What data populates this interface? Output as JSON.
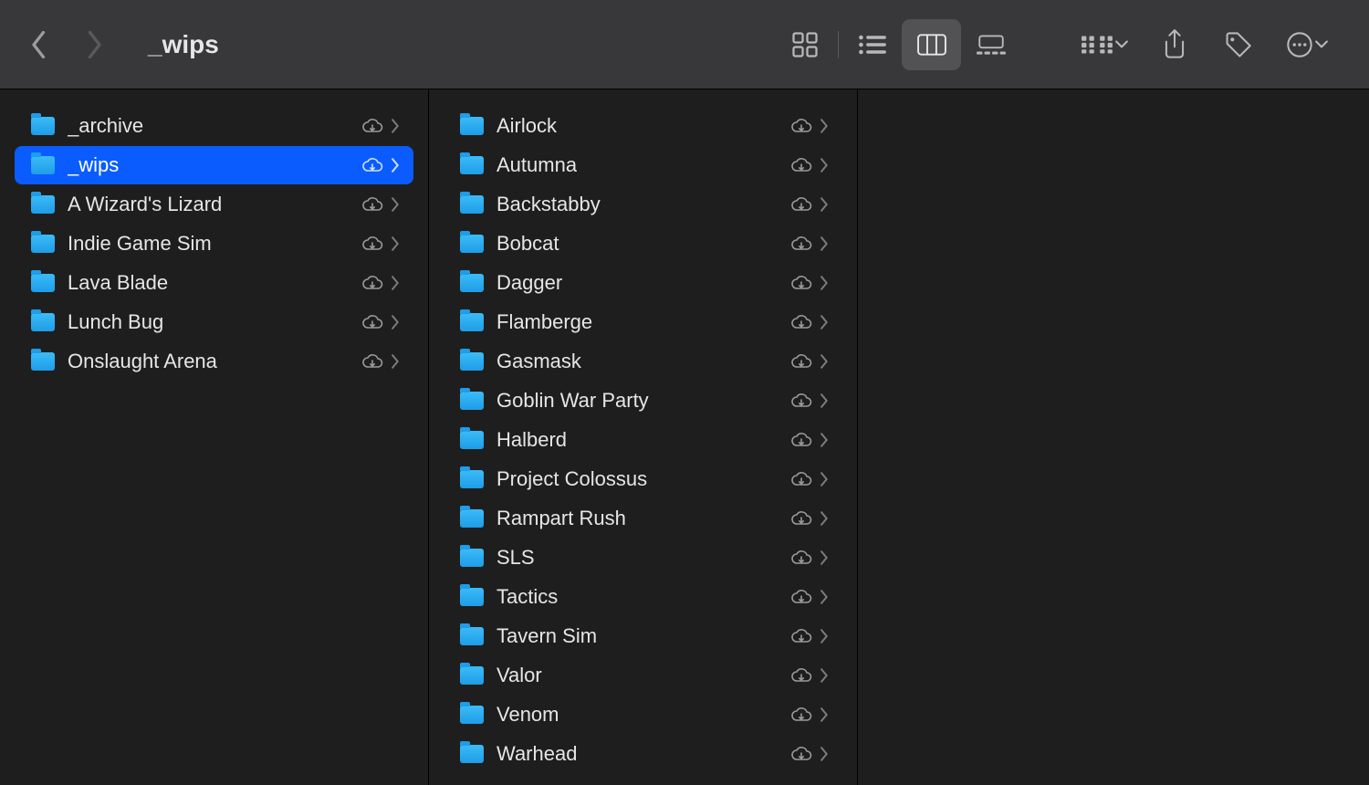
{
  "toolbar": {
    "title": "_wips",
    "view_mode": "column"
  },
  "columns": [
    {
      "items": [
        {
          "name": "_archive"
        },
        {
          "name": "_wips",
          "selected": true
        },
        {
          "name": "A Wizard's Lizard"
        },
        {
          "name": "Indie Game Sim"
        },
        {
          "name": "Lava Blade"
        },
        {
          "name": "Lunch Bug"
        },
        {
          "name": "Onslaught Arena"
        }
      ]
    },
    {
      "items": [
        {
          "name": "Airlock"
        },
        {
          "name": "Autumna"
        },
        {
          "name": "Backstabby"
        },
        {
          "name": "Bobcat"
        },
        {
          "name": "Dagger"
        },
        {
          "name": "Flamberge"
        },
        {
          "name": "Gasmask"
        },
        {
          "name": "Goblin War Party"
        },
        {
          "name": "Halberd"
        },
        {
          "name": "Project Colossus"
        },
        {
          "name": "Rampart Rush"
        },
        {
          "name": "SLS"
        },
        {
          "name": "Tactics"
        },
        {
          "name": "Tavern Sim"
        },
        {
          "name": "Valor"
        },
        {
          "name": "Venom"
        },
        {
          "name": "Warhead"
        }
      ]
    }
  ]
}
